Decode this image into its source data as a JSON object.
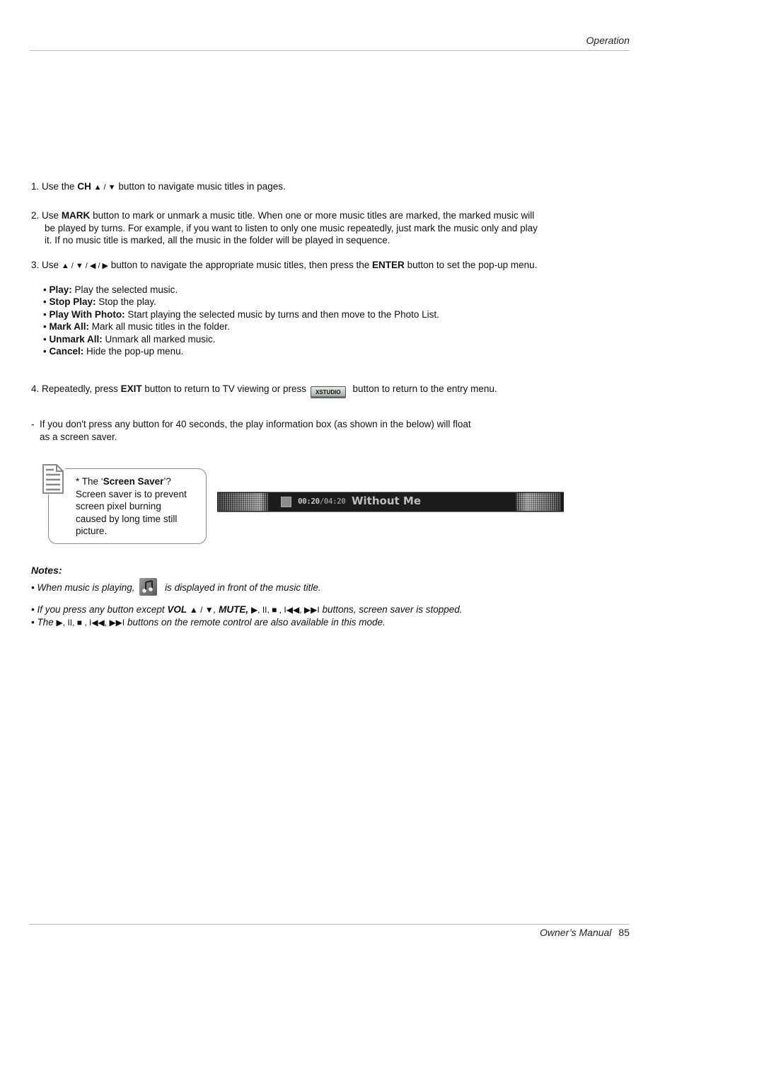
{
  "header": {
    "section": "Operation"
  },
  "steps": {
    "step1": {
      "num": "1.",
      "pre": "Use the",
      "key": "CH",
      "keys_glyph": "▲ / ▼",
      "post": "button to navigate music titles in pages."
    },
    "step2": {
      "num": "2.",
      "pre": "Use",
      "key": "MARK",
      "line1_post": "button to mark or unmark a music title. When one or more music titles are marked, the marked music will",
      "line2": "be played by turns. For example, if you want to listen to only one music repeatedly, just mark the music only and play",
      "line3": "it. If no music title is marked, all the music in the folder  will be played in sequence."
    },
    "step3": {
      "num": "3.",
      "pre": "Use",
      "keys_glyph": "▲ / ▼ / ◀ / ▶",
      "mid": "button to navigate the appropriate music titles, then press the",
      "key": "ENTER",
      "post": "button to set the pop-up  menu."
    },
    "menu_options": [
      {
        "label": "Play:",
        "desc": "Play the selected music."
      },
      {
        "label": "Stop Play:",
        "desc": "Stop the play."
      },
      {
        "label": "Play With Photo:",
        "desc": "Start playing the selected music by turns and then move to the Photo List."
      },
      {
        "label": "Mark All:",
        "desc": "Mark all music titles in the folder."
      },
      {
        "label": "Unmark All:",
        "desc": "Unmark all marked music."
      },
      {
        "label": "Cancel:",
        "desc": "Hide the pop-up menu."
      }
    ],
    "step4": {
      "num": "4.",
      "pre": "Repeatedly, press",
      "key": "EXIT",
      "mid": "button to return to TV viewing or press",
      "button_label": "XSTUDIO",
      "post": "button to return to the entry menu."
    },
    "dash_note": {
      "bullet": "-",
      "line1": "If you don't press any button for 40 seconds, the play information box (as shown in the below) will float",
      "line2": "as a screen saver."
    }
  },
  "tip_box": {
    "icon": "note-document-icon",
    "title_pre": "* The ‘",
    "title_bold": "Screen Saver",
    "title_post": "’?",
    "body": [
      "Screen saver is to prevent",
      "screen pixel burning",
      "caused by long time still",
      "picture."
    ]
  },
  "screen_saver_bar": {
    "status_icon": "stop-square-icon",
    "elapsed": "00:20",
    "separator": "/",
    "total": "04:20",
    "track_title": "Without Me"
  },
  "notes": {
    "title": "Notes:",
    "items": [
      {
        "pre": "• When music is playing,",
        "icon": "music-note-icon",
        "post": "is displayed in front of the music title."
      },
      {
        "pre": "• If you press any button except",
        "key1": "VOL",
        "key1_glyph": "▲ / ▼",
        "key2": "MUTE,",
        "controls": "▶, II, ■ , I◀◀, ▶▶I",
        "post": "buttons, screen saver is stopped."
      },
      {
        "pre": "• The",
        "controls": "▶, II, ■ , I◀◀, ▶▶I",
        "post": "buttons on the remote control are also available in this mode."
      }
    ]
  },
  "footer": {
    "title": "Owner’s Manual",
    "page": "85"
  }
}
